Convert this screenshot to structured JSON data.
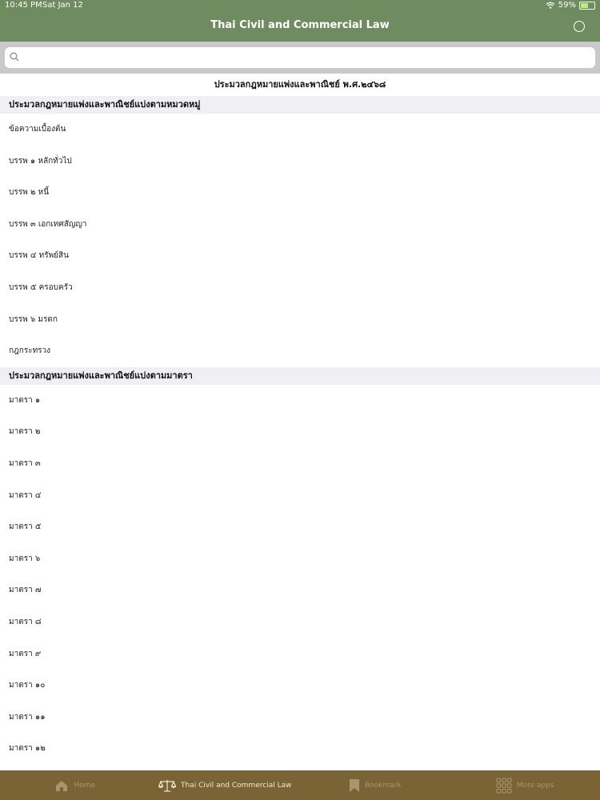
{
  "status_bar": {
    "time": "10:45 PM",
    "date": "Sat Jan 12",
    "battery": "59%",
    "battery_level": 0.59
  },
  "nav": {
    "title": "Thai Civil and Commercial Law",
    "user_icon": "user-circle-icon"
  },
  "search": {
    "placeholder": "",
    "value": ""
  },
  "content_title": "ประมวลกฎหมายแพ่งและพาณิชย์ พ.ศ.๒๔๖๘",
  "sections": [
    {
      "header": "ประมวลกฎหมายแพ่งและพาณิชย์แบ่งตามหมวดหมู่",
      "items": [
        "ข้อความเบื้องต้น",
        "บรรพ ๑ หลักทั่วไป",
        "บรรพ ๒ หนี้",
        "บรรพ ๓ เอกเทศสัญญา",
        "บรรพ ๔ ทรัพย์สิน",
        "บรรพ ๕ ครอบครัว",
        "บรรพ ๖ มรดก",
        "กฎกระทรวง"
      ]
    },
    {
      "header": "ประมวลกฎหมายแพ่งและพาณิชย์แบ่งตามมาตรา",
      "items": [
        "มาตรา ๑",
        "มาตรา ๒",
        "มาตรา ๓",
        "มาตรา ๔",
        "มาตรา ๕",
        "มาตรา ๖",
        "มาตรา ๗",
        "มาตรา ๘",
        "มาตรา ๙",
        "มาตรา ๑๐",
        "มาตรา ๑๑",
        "มาตรา ๑๒"
      ]
    }
  ],
  "tabs": [
    {
      "label": "Home",
      "icon": "home-icon",
      "active": false
    },
    {
      "label": "Thai Civil and Commercial Law",
      "icon": "scales-icon",
      "active": true
    },
    {
      "label": "Bookmark",
      "icon": "bookmark-icon",
      "active": false
    },
    {
      "label": "More apps",
      "icon": "apps-grid-icon",
      "active": false
    }
  ],
  "colors": {
    "nav_bg": "#6f8c60",
    "tab_bg": "#7a6435",
    "section_bg": "#efeff4",
    "search_bg": "#c9c9cc"
  }
}
